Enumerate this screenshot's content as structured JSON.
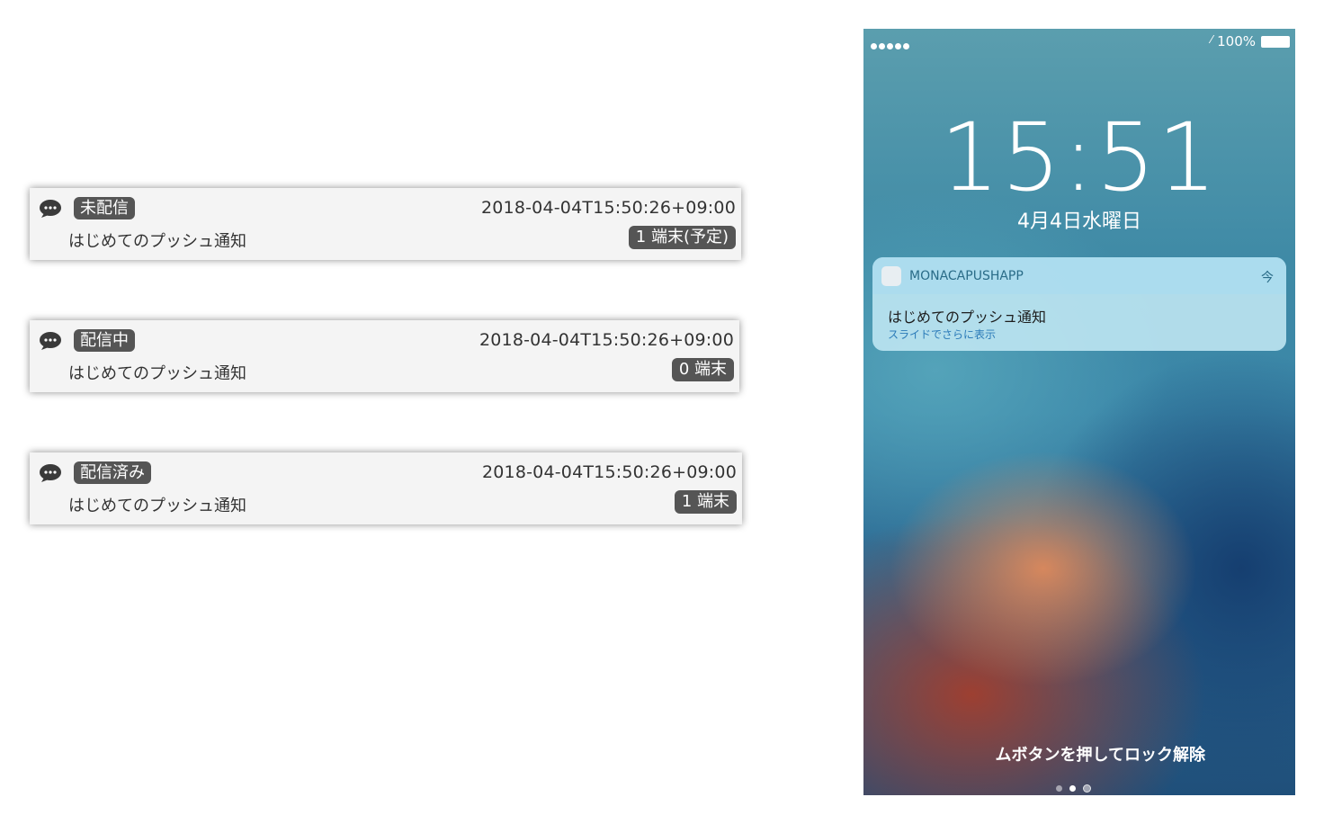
{
  "notifications": [
    {
      "status": "未配信",
      "title": "はじめてのプッシュ通知",
      "timestamp": "2018-04-04T15:50:26+09:00",
      "devices": "1 端末(予定)"
    },
    {
      "status": "配信中",
      "title": "はじめてのプッシュ通知",
      "timestamp": "2018-04-04T15:50:26+09:00",
      "devices": "0 端末"
    },
    {
      "status": "配信済み",
      "title": "はじめてのプッシュ通知",
      "timestamp": "2018-04-04T15:50:26+09:00",
      "devices": "1 端末"
    }
  ],
  "lockscreen": {
    "battery": "100%",
    "time": "15:51",
    "date": "4月4日水曜日",
    "notification": {
      "app_name": "MONACAPUSHAPP",
      "time": "今",
      "message": "はじめてのプッシュ通知",
      "hint": "スライドでさらに表示"
    },
    "unlock_text": "ムボタンを押してロック解除"
  },
  "icons": {
    "card": "speech-bubble-icon",
    "status_bar": [
      "signal-dots-icon",
      "charging-bolt-icon",
      "battery-icon"
    ],
    "notification": "app-icon",
    "pager": "camera-icon"
  },
  "colors": {
    "badge": "#555555",
    "card_background": "#f4f4f4",
    "notification_accent": "#2a7ab8"
  }
}
